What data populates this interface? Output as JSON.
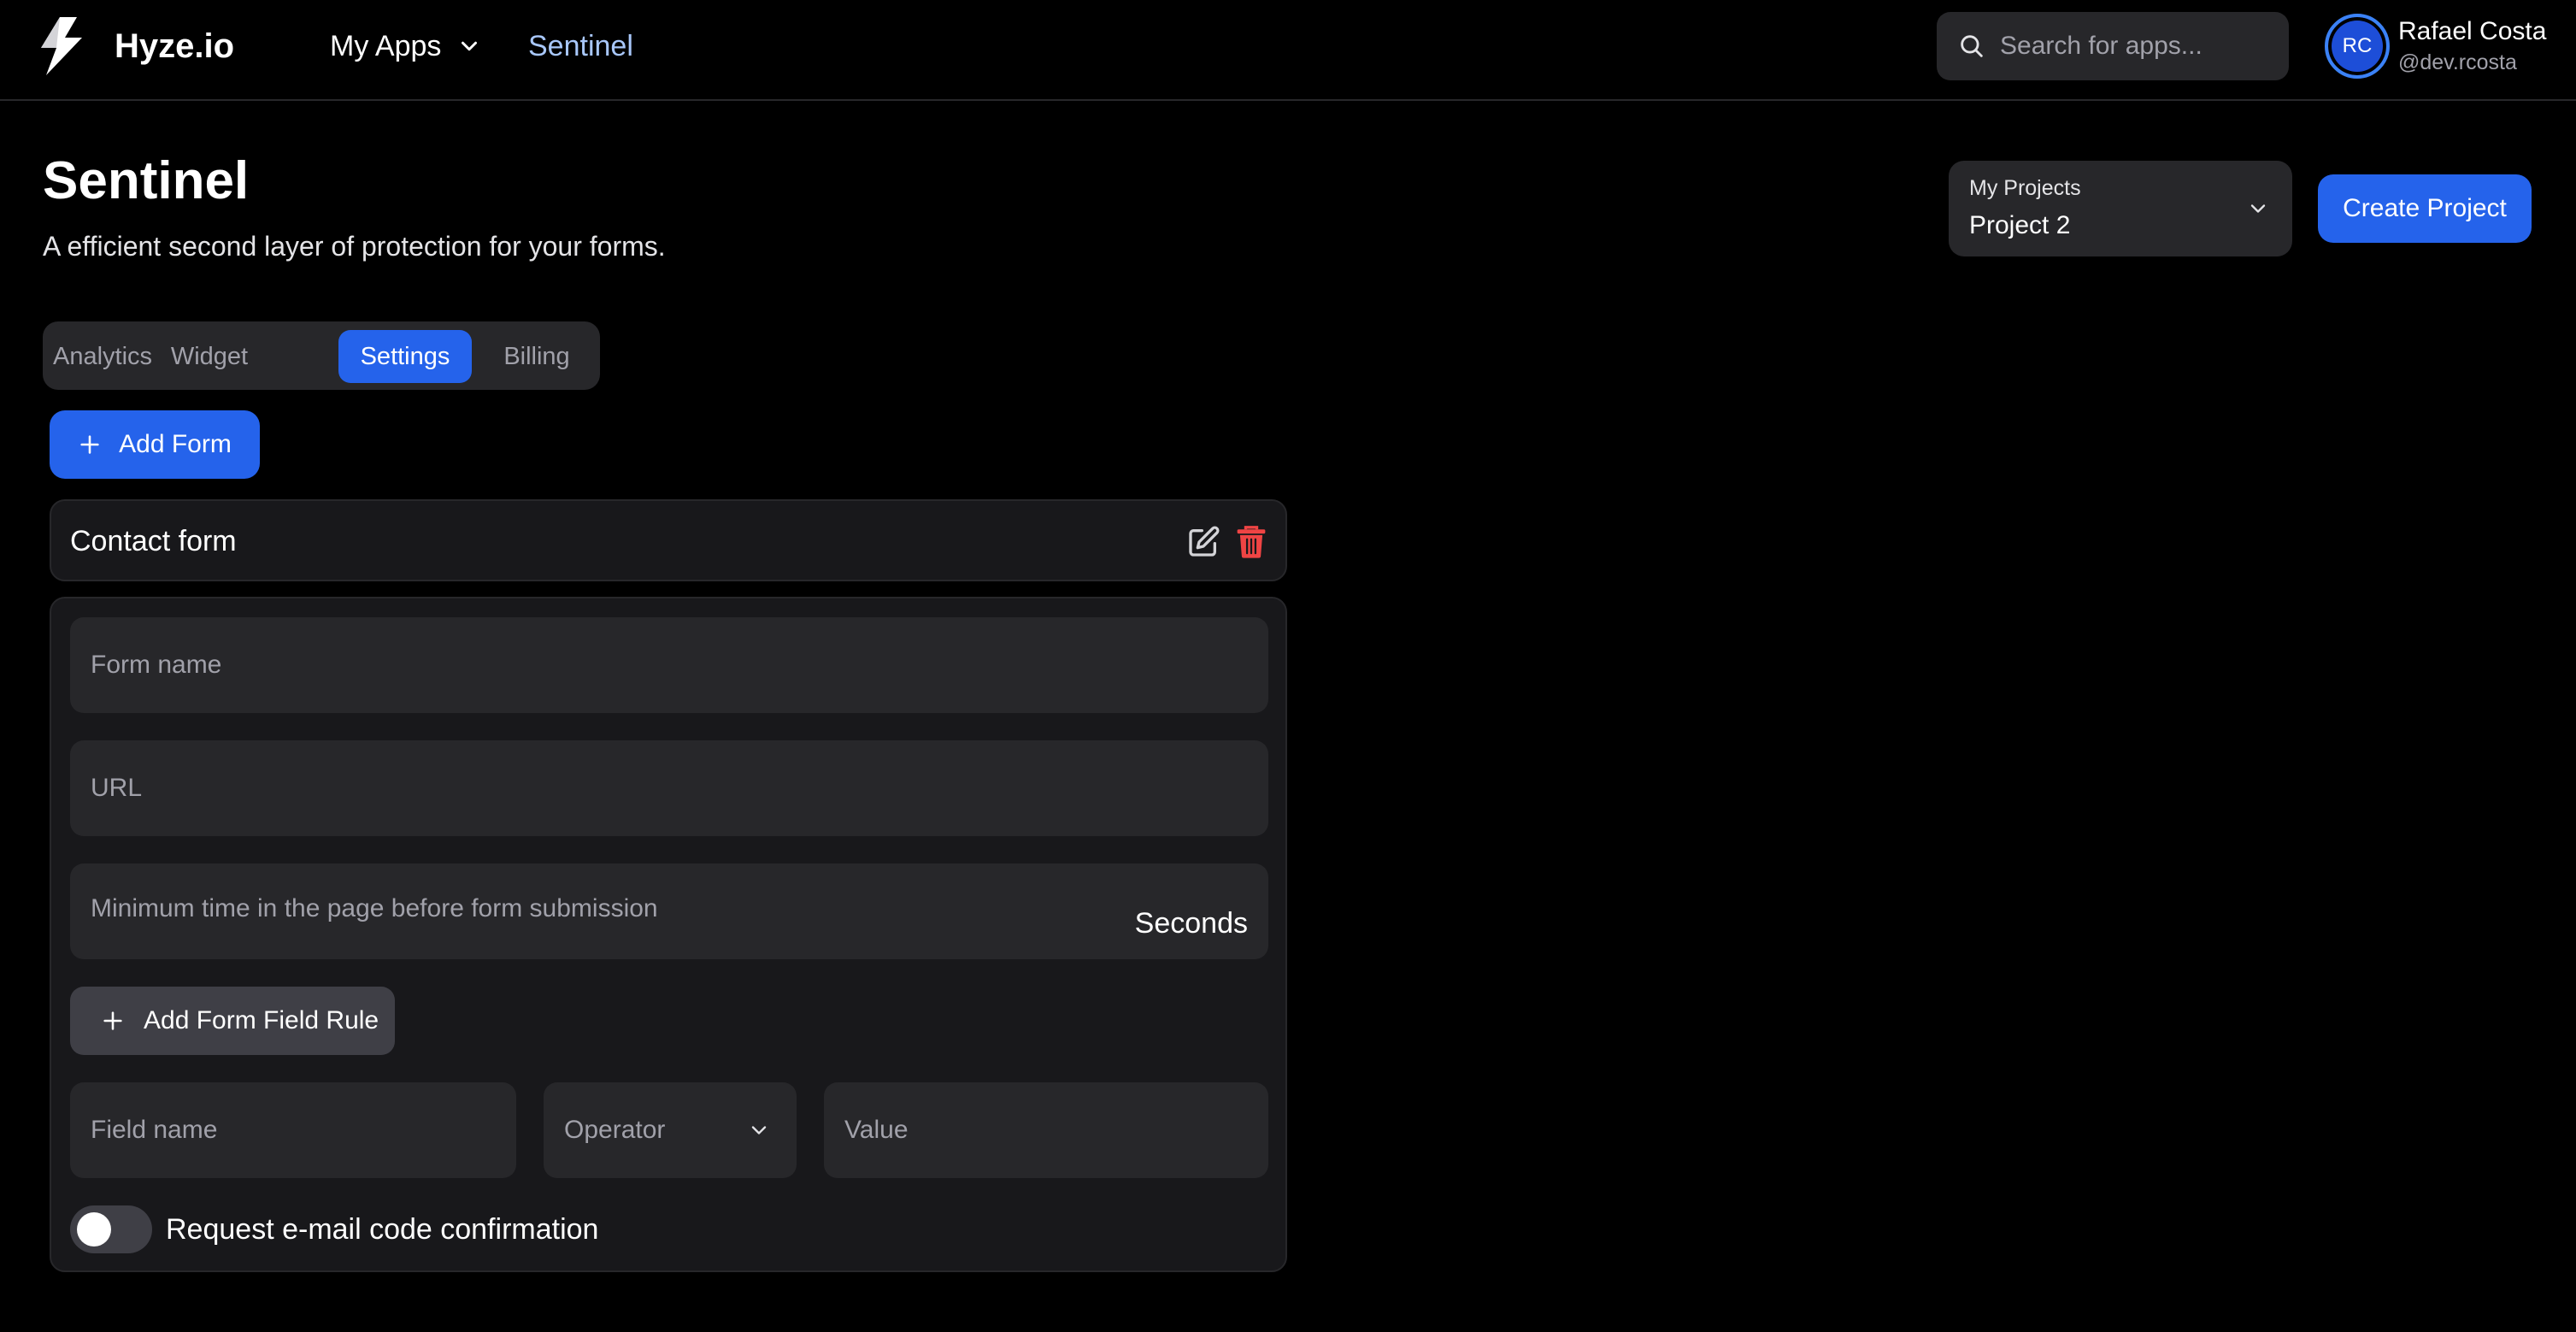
{
  "nav": {
    "brand": "Hyze.io",
    "my_apps": "My Apps",
    "current_app": "Sentinel",
    "search_placeholder": "Search for apps..."
  },
  "user": {
    "initials": "RC",
    "name": "Rafael Costa",
    "handle": "@dev.rcosta"
  },
  "header": {
    "title": "Sentinel",
    "subtitle": "A efficient second layer of protection for your forms."
  },
  "project": {
    "label": "My Projects",
    "selected": "Project 2",
    "create_label": "Create Project"
  },
  "tabs": [
    {
      "label": "Analytics",
      "active": false
    },
    {
      "label": "Widget",
      "active": false
    },
    {
      "label": "Settings",
      "active": true
    },
    {
      "label": "Billing",
      "active": false
    }
  ],
  "add_form_label": "Add Form",
  "form": {
    "title": "Contact form",
    "form_name_placeholder": "Form name",
    "url_placeholder": "URL",
    "min_time_placeholder": "Minimum time in the page before form submission",
    "min_time_suffix": "Seconds",
    "add_rule_label": "Add Form Field Rule",
    "field_name_placeholder": "Field name",
    "operator_placeholder": "Operator",
    "value_placeholder": "Value",
    "email_confirm_label": "Request e-mail code confirmation",
    "email_confirm_enabled": false
  },
  "colors": {
    "accent": "#2563eb",
    "active_link": "#a8c7fa",
    "danger": "#ef4444",
    "surface": "#27272a",
    "card": "#18181b"
  }
}
